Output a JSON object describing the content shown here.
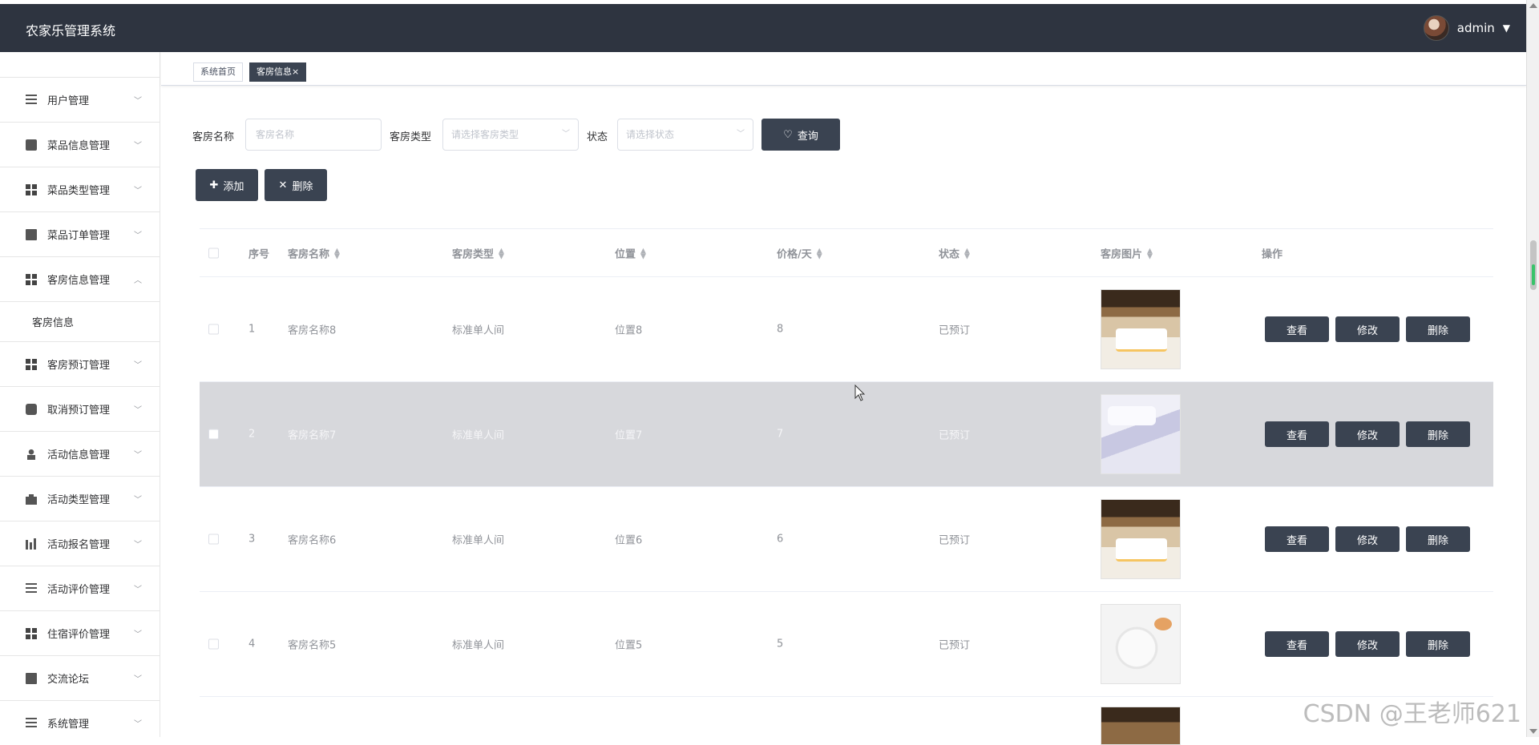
{
  "app": {
    "title": "农家乐管理系统"
  },
  "user": {
    "name": "admin"
  },
  "sidebar": {
    "items": [
      {
        "label": "用户管理",
        "icon": "list-icon",
        "expanded": false
      },
      {
        "label": "菜品信息管理",
        "icon": "briefcase-icon",
        "expanded": false
      },
      {
        "label": "菜品类型管理",
        "icon": "grid-icon",
        "expanded": false
      },
      {
        "label": "菜品订单管理",
        "icon": "monitor-icon",
        "expanded": false
      },
      {
        "label": "客房信息管理",
        "icon": "grid-icon",
        "expanded": true,
        "children": [
          {
            "label": "客房信息"
          }
        ]
      },
      {
        "label": "客房预订管理",
        "icon": "grid-icon",
        "expanded": false
      },
      {
        "label": "取消预订管理",
        "icon": "chat-icon",
        "expanded": false
      },
      {
        "label": "活动信息管理",
        "icon": "user-icon",
        "expanded": false
      },
      {
        "label": "活动类型管理",
        "icon": "bag-icon",
        "expanded": false
      },
      {
        "label": "活动报名管理",
        "icon": "bars-icon",
        "expanded": false
      },
      {
        "label": "活动评价管理",
        "icon": "sliders-icon",
        "expanded": false
      },
      {
        "label": "住宿评价管理",
        "icon": "grid-icon",
        "expanded": false
      },
      {
        "label": "交流论坛",
        "icon": "clipboard-icon",
        "expanded": false
      },
      {
        "label": "系统管理",
        "icon": "list-icon",
        "expanded": false
      }
    ]
  },
  "tabs": [
    {
      "label": "系统首页",
      "active": false
    },
    {
      "label": "客房信息",
      "active": true,
      "close": "×"
    }
  ],
  "search": {
    "name_label": "客房名称",
    "name_placeholder": "客房名称",
    "type_label": "客房类型",
    "type_placeholder": "请选择客房类型",
    "status_label": "状态",
    "status_placeholder": "请选择状态",
    "query_button": "查询"
  },
  "actions": {
    "add": "添加",
    "delete": "删除"
  },
  "table": {
    "headers": [
      "序号",
      "客房名称",
      "客房类型",
      "位置",
      "价格/天",
      "状态",
      "客房图片",
      "操作"
    ],
    "rows": [
      {
        "index": "1",
        "name": "客房名称8",
        "type": "标准单人间",
        "location": "位置8",
        "price": "8",
        "status": "已预订",
        "image": "lobby"
      },
      {
        "index": "2",
        "name": "客房名称7",
        "type": "标准单人间",
        "location": "位置7",
        "price": "7",
        "status": "已预订",
        "image": "bed"
      },
      {
        "index": "3",
        "name": "客房名称6",
        "type": "标准单人间",
        "location": "位置6",
        "price": "6",
        "status": "已预订",
        "image": "lobby"
      },
      {
        "index": "4",
        "name": "客房名称5",
        "type": "标准单人间",
        "location": "位置5",
        "price": "5",
        "status": "已预订",
        "image": "plate"
      }
    ],
    "row_actions": {
      "view": "查看",
      "edit": "修改",
      "delete": "删除"
    }
  },
  "watermark": "CSDN @王老师621",
  "colors": {
    "topbar": "#2e3440",
    "button": "#3a4351",
    "hover_row": "#d7d8dc"
  }
}
